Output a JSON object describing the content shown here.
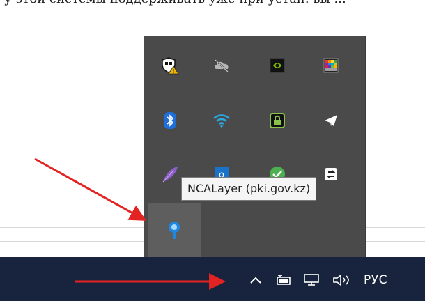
{
  "page": {
    "partial_text": "у этой системы поддерживать уже при устан. вы ..."
  },
  "tray_overflow": {
    "icons": [
      {
        "name": "windows-security-icon"
      },
      {
        "name": "onedrive-offline-icon"
      },
      {
        "name": "nvidia-icon"
      },
      {
        "name": "color-palette-icon"
      },
      {
        "name": "bluetooth-icon"
      },
      {
        "name": "wifi-icon"
      },
      {
        "name": "lock-app-icon"
      },
      {
        "name": "telegram-icon"
      },
      {
        "name": "feather-app-icon"
      },
      {
        "name": "outlook-icon"
      },
      {
        "name": "checkmark-app-icon"
      },
      {
        "name": "sync-app-icon"
      },
      {
        "name": "ncalayer-icon"
      }
    ],
    "tooltip": "NCALayer (pki.gov.kz)"
  },
  "taskbar": {
    "chevron": "^",
    "language": "РУС",
    "battery_icon": "battery-icon",
    "network_icon": "network-icon",
    "volume_icon": "volume-icon"
  },
  "annotations": {
    "arrow_color": "#e32222"
  }
}
